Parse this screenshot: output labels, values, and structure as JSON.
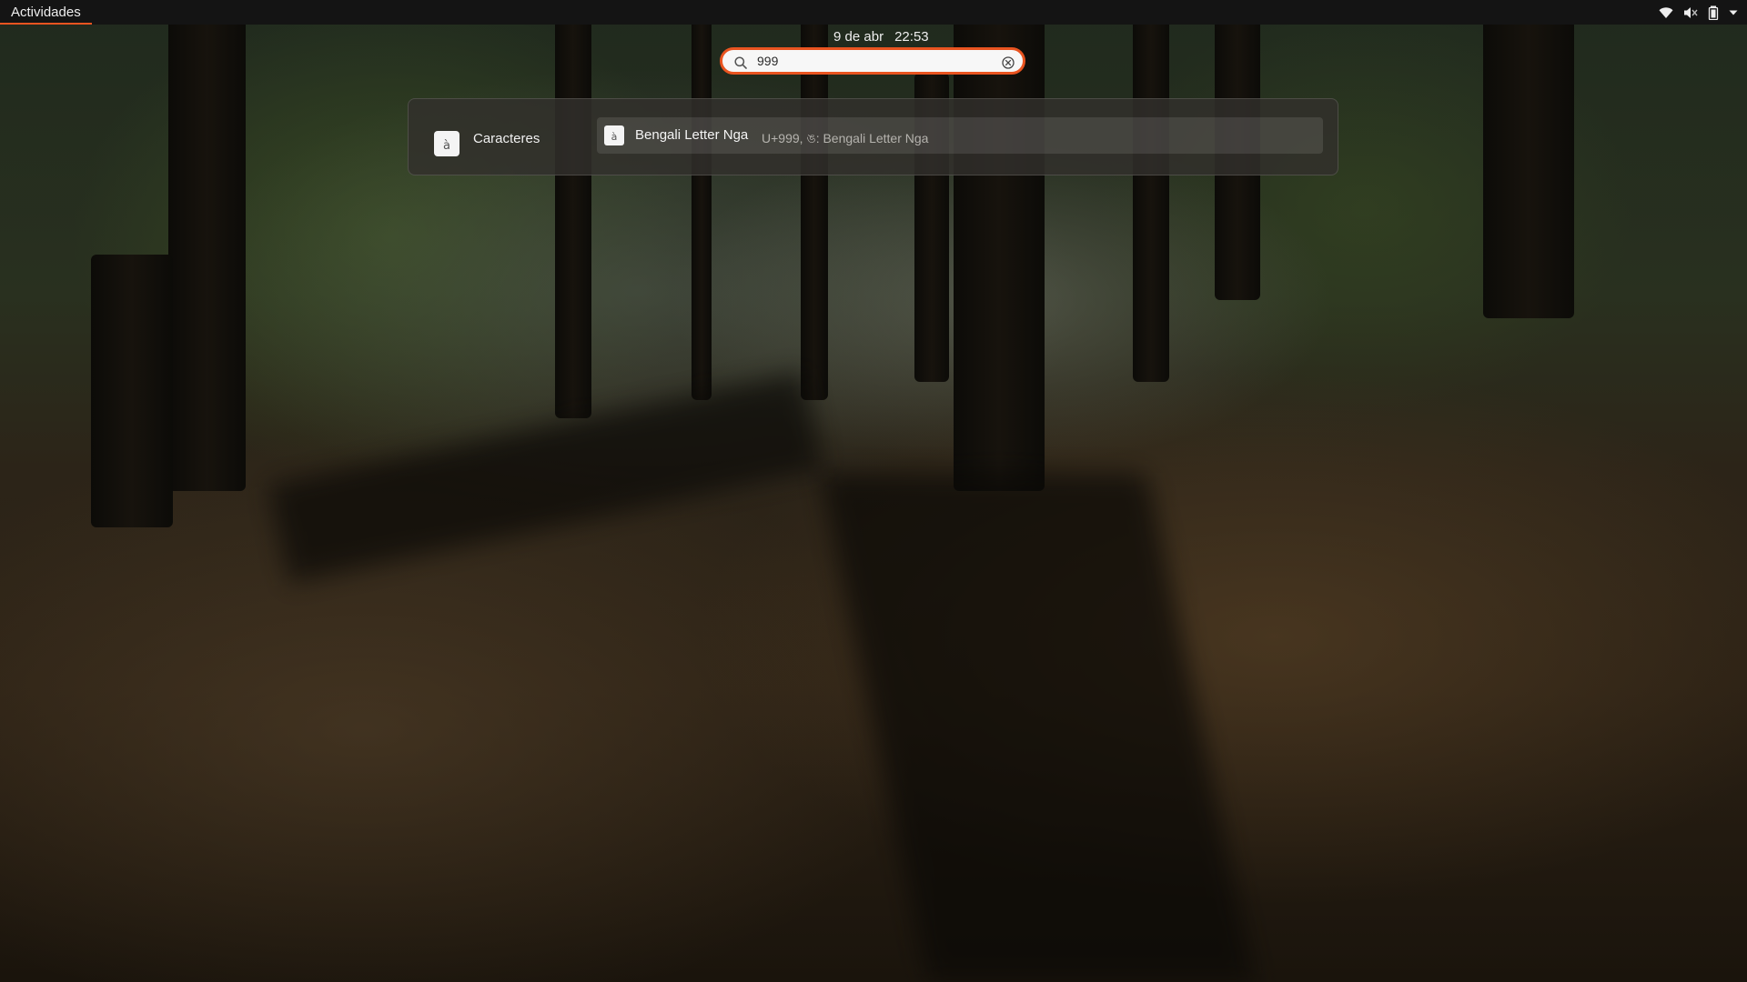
{
  "top_bar": {
    "activities_label": "Actividades",
    "clock_date": "9 de abr",
    "clock_time": "22:53",
    "tray_icons": [
      "wifi-icon",
      "volume-muted-icon",
      "battery-icon",
      "system-menu-arrow-icon"
    ]
  },
  "search": {
    "value": "999",
    "icon": "search-icon",
    "clear_icon": "clear-icon"
  },
  "results": {
    "provider": {
      "label": "Caracteres",
      "icon_glyph": "à"
    },
    "items": [
      {
        "icon_glyph": "à",
        "title": "Bengali Letter Nga",
        "description": "U+999, ঙ: Bengali Letter Nga"
      }
    ]
  },
  "colors": {
    "accent": "#e95420",
    "top_bar": "#141414",
    "panel": "#32302c"
  }
}
